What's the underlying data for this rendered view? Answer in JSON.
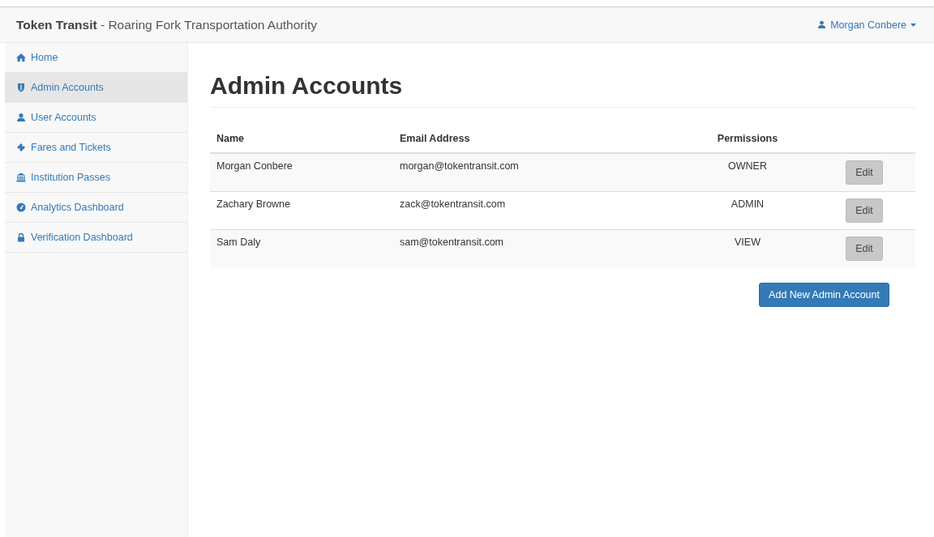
{
  "navbar": {
    "brand": "Token Transit",
    "subtitle": " - Roaring Fork Transportation Authority",
    "user": "Morgan Conbere"
  },
  "sidebar": {
    "items": [
      {
        "label": "Home",
        "selected": false
      },
      {
        "label": "Admin Accounts",
        "selected": true
      },
      {
        "label": "User Accounts",
        "selected": false
      },
      {
        "label": "Fares and Tickets",
        "selected": false
      },
      {
        "label": "Institution Passes",
        "selected": false
      },
      {
        "label": "Analytics Dashboard",
        "selected": false
      },
      {
        "label": "Verification Dashboard",
        "selected": false
      }
    ]
  },
  "page_title": "Admin Accounts",
  "table": {
    "columns": [
      "Name",
      "Email Address",
      "Permissions"
    ],
    "rows": [
      {
        "name": "Morgan Conbere",
        "email": "morgan@tokentransit.com",
        "permissions": "OWNER",
        "action": "Edit"
      },
      {
        "name": "Zachary Browne",
        "email": "zack@tokentransit.com",
        "permissions": "ADMIN",
        "action": "Edit"
      },
      {
        "name": "Sam Daly",
        "email": "sam@tokentransit.com",
        "permissions": "VIEW",
        "action": "Edit"
      }
    ]
  },
  "add_button": "Add New Admin Account"
}
